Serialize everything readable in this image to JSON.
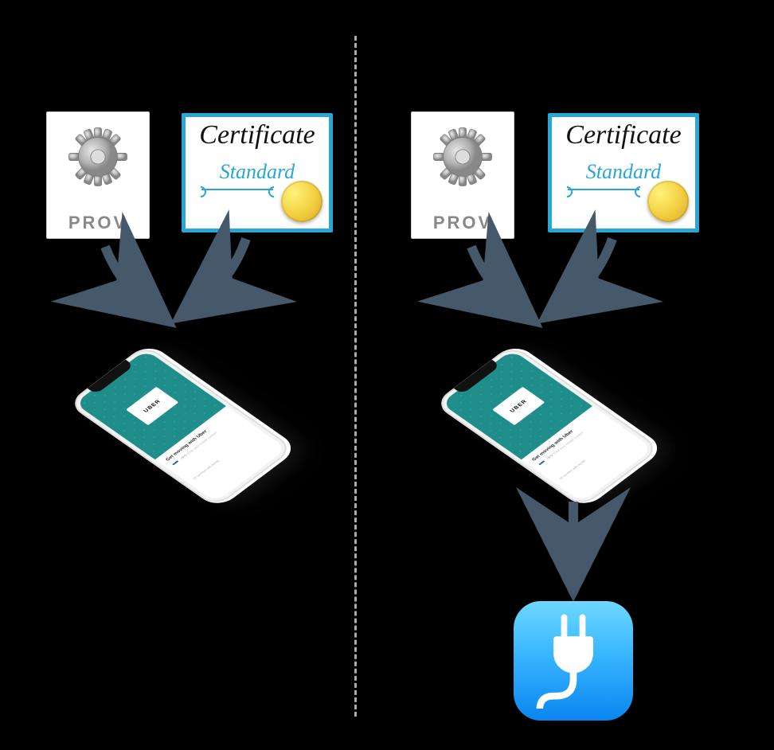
{
  "prov": {
    "label": "PROV"
  },
  "certificate": {
    "title": "Certificate",
    "subtitle": "Standard"
  },
  "phone": {
    "brand": "UBER",
    "headline": "Get moving with Uber",
    "country_code": "+972",
    "hint": "Enter your mobile number",
    "social": "Or connect with social"
  },
  "configurator": {
    "name": "Apple Configurator"
  }
}
